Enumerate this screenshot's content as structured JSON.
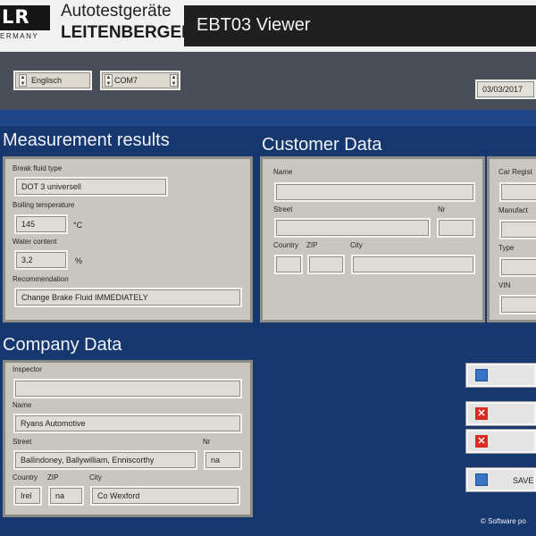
{
  "brand": {
    "logo_text": "LR",
    "country": "ERMANY",
    "line1": "Autotestgeräte",
    "line2": "LEITENBERGER"
  },
  "app_title": "EBT03 Viewer",
  "toolbar": {
    "language": "Englisch",
    "port": "COM7",
    "date": "03/03/2017"
  },
  "measurement": {
    "title": "Measurement results",
    "brake_fluid_label": "Break fluid type",
    "brake_fluid_value": "DOT 3 universell",
    "boiling_label": "Boiling temperature",
    "boiling_value": "145",
    "boiling_unit": "°C",
    "water_label": "Water content",
    "water_value": "3,2",
    "water_unit": "%",
    "recommendation_label": "Recommendation",
    "recommendation_value": "Change Brake Fluid IMMEDIATELY"
  },
  "customer": {
    "title": "Customer Data",
    "name_label": "Name",
    "name_value": "",
    "street_label": "Street",
    "street_value": "",
    "nr_label": "Nr",
    "nr_value": "",
    "country_label": "Country",
    "zip_label": "ZIP",
    "city_label": "City",
    "country_value": "",
    "zip_value": "",
    "city_value": ""
  },
  "car": {
    "registration_label": "Car Regist",
    "manufacturer_label": "Manufact",
    "type_label": "Type",
    "vin_label": "VIN"
  },
  "company": {
    "title": "Company Data",
    "inspector_label": "Inspector",
    "inspector_value": "",
    "name_label": "Name",
    "name_value": "Ryans Automotive",
    "street_label": "Street",
    "street_value": "Ballindoney, Ballywilliam, Enniscorthy",
    "nr_label": "Nr",
    "nr_value": "na",
    "country_label": "Country",
    "zip_label": "ZIP",
    "city_label": "City",
    "country_value": "Irel",
    "zip_value": "na",
    "city_value": "Co Wexford"
  },
  "actions": {
    "save_label": "SAVE"
  },
  "footer": "© Software po",
  "icons": [
    "spinner-icon",
    "document-icon",
    "close-icon"
  ],
  "colors": {
    "background": "#1a3d78",
    "header": "#f1f1f1",
    "title_bar": "#1f1f1f",
    "toolbar": "#4a4e58",
    "panel": "#c9c6bf",
    "delete_icon": "#d92a23"
  }
}
